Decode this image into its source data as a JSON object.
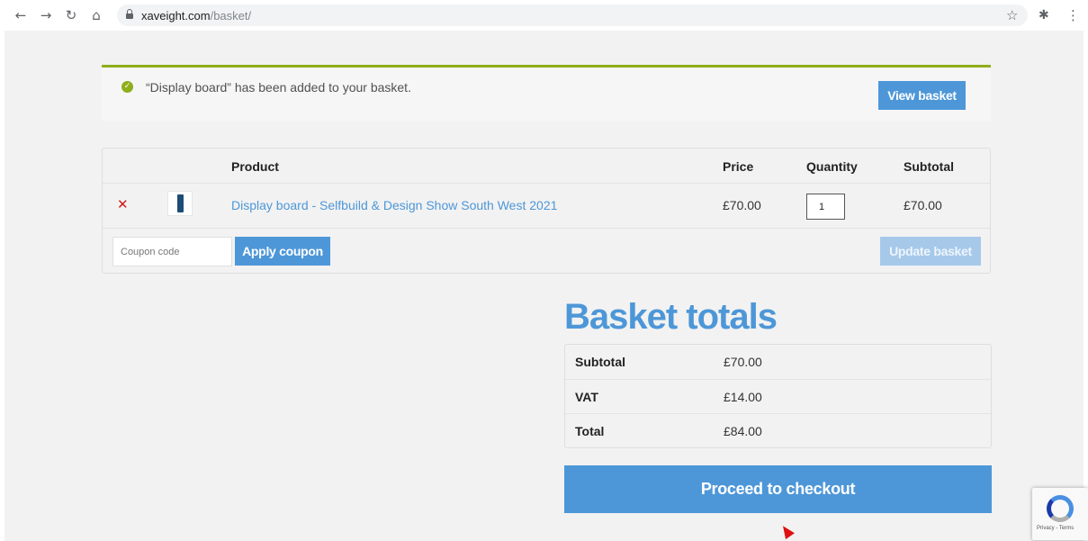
{
  "browser": {
    "url_domain": "xaveight.com",
    "url_path": "/basket/",
    "icons": [
      "back-icon",
      "forward-icon",
      "reload-icon",
      "home-icon",
      "lock-icon",
      "star-icon",
      "extensions-icon",
      "menu-icon"
    ]
  },
  "notice": {
    "message": "“Display board” has been added to your basket.",
    "view_basket_label": "View basket",
    "accent_color": "#8fae1b"
  },
  "cart": {
    "headers": {
      "product": "Product",
      "price": "Price",
      "quantity": "Quantity",
      "subtotal": "Subtotal"
    },
    "items": [
      {
        "name": "Display board - Selfbuild & Design Show South West 2021",
        "price": "£70.00",
        "quantity": "1",
        "subtotal": "£70.00"
      }
    ],
    "coupon_placeholder": "Coupon code",
    "apply_coupon_label": "Apply coupon",
    "update_basket_label": "Update basket"
  },
  "totals": {
    "title": "Basket totals",
    "rows": [
      {
        "label": "Subtotal",
        "value": "£70.00"
      },
      {
        "label": "VAT",
        "value": "£14.00"
      },
      {
        "label": "Total",
        "value": "£84.00"
      }
    ],
    "checkout_label": "Proceed to checkout"
  },
  "recaptcha": {
    "text": "Privacy - Terms"
  },
  "colors": {
    "brand_blue": "#4d97d8",
    "remove_red": "#d21a1a"
  }
}
